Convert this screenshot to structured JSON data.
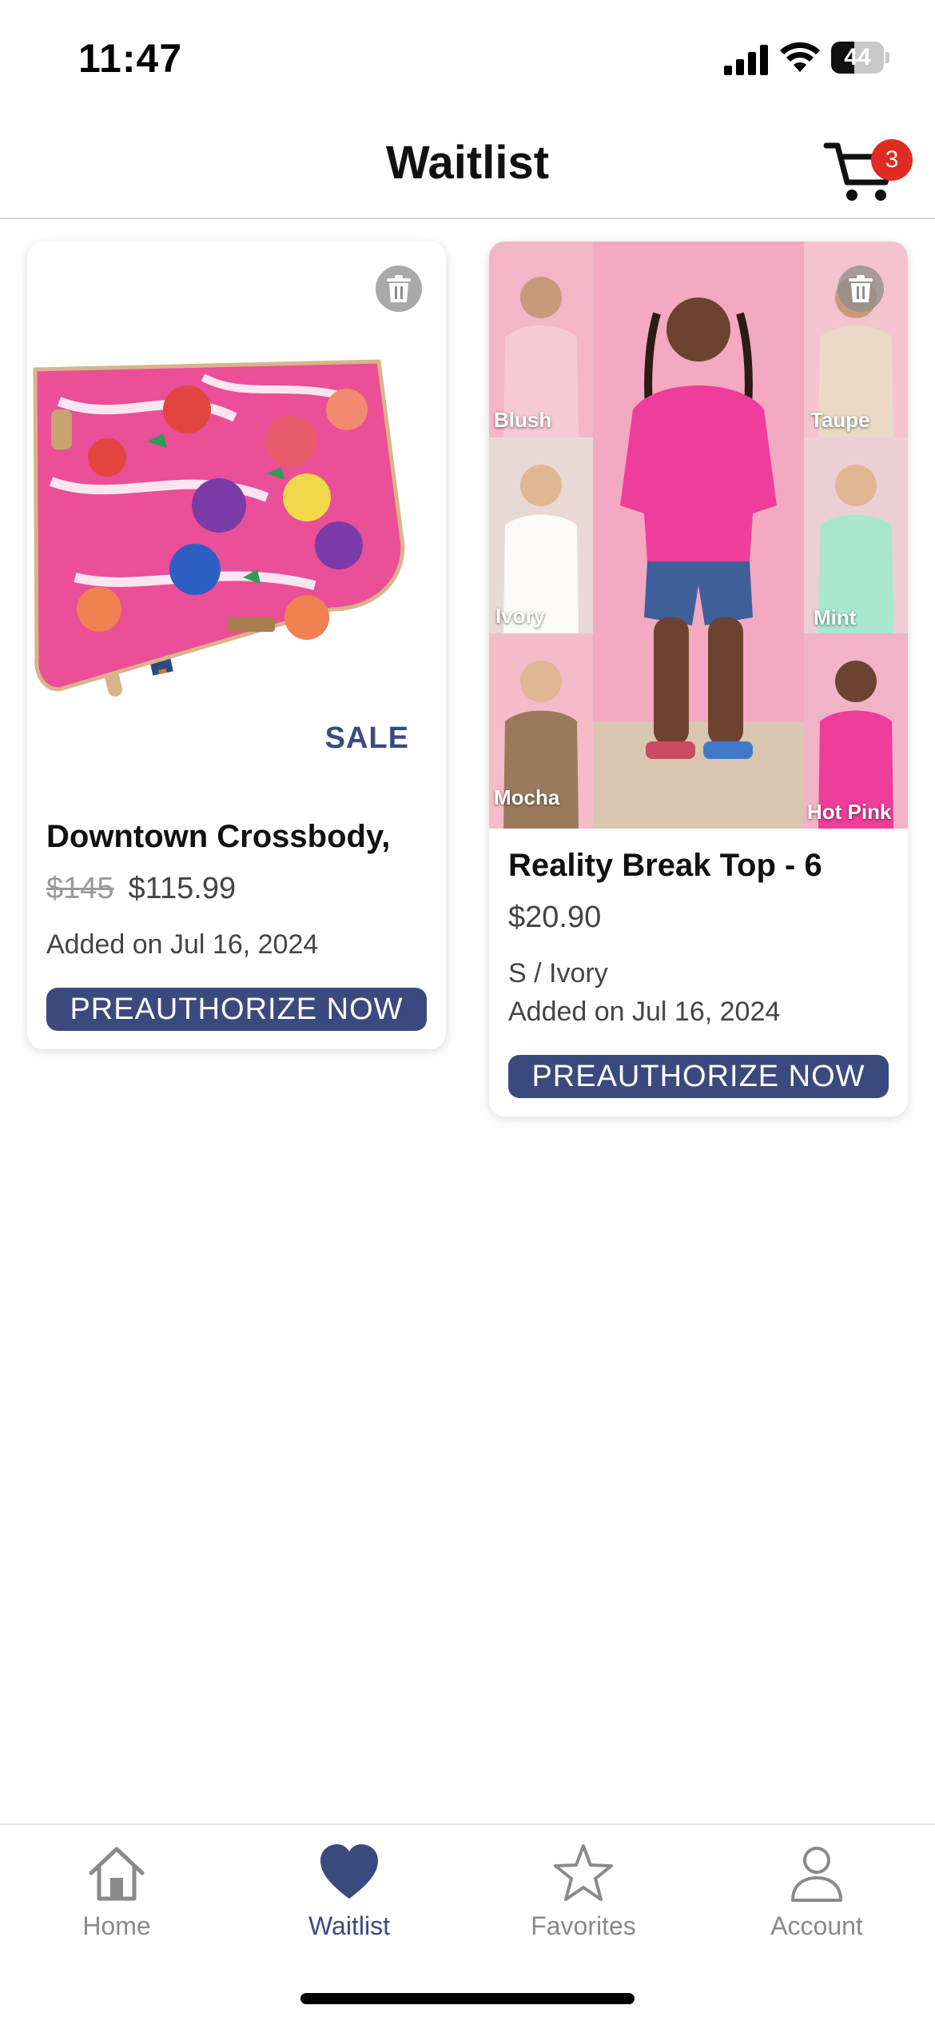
{
  "status_bar": {
    "time": "11:47",
    "battery_level": "44",
    "battery_fraction": 0.44,
    "icons": [
      "signal-icon",
      "wifi-icon",
      "battery-icon"
    ]
  },
  "header": {
    "title": "Waitlist",
    "cart_count": "3",
    "cart_icon": "cart-icon"
  },
  "items": [
    {
      "badge": "SALE",
      "title": "Downtown Crossbody,",
      "original_price": "$145",
      "price": "$115.99",
      "variant": "",
      "added": "Added on Jul 16, 2024",
      "action": "PREAUTHORIZE NOW",
      "delete_icon": "trash-icon"
    },
    {
      "badge": "",
      "title": "Reality Break Top - 6",
      "original_price": "",
      "price": "$20.90",
      "variant": "S / Ivory",
      "added": "Added on Jul 16, 2024",
      "action": "PREAUTHORIZE NOW",
      "delete_icon": "trash-icon",
      "color_swatches": [
        "Blush",
        "Taupe",
        "Ivory",
        "Mint",
        "Mocha",
        "Hot Pink"
      ]
    }
  ],
  "tab_bar": {
    "tabs": [
      {
        "label": "Home",
        "icon": "home-icon",
        "active": false
      },
      {
        "label": "Waitlist",
        "icon": "heart-icon",
        "active": true
      },
      {
        "label": "Favorites",
        "icon": "star-icon",
        "active": false
      },
      {
        "label": "Account",
        "icon": "person-icon",
        "active": false
      }
    ]
  },
  "colors": {
    "accent": "#3b4a7e",
    "badge_red": "#e02a22",
    "inactive_gray": "#8a8a8a"
  }
}
